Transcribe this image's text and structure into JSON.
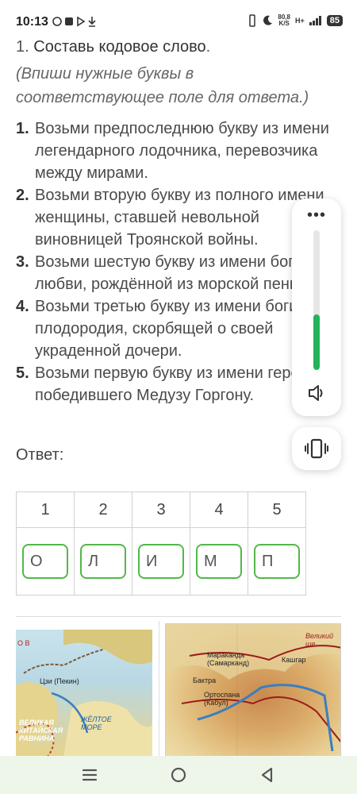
{
  "status_bar": {
    "time": "10:13",
    "speed_value": "80,8",
    "speed_unit": "K/S",
    "network": "H+",
    "battery": "85"
  },
  "task": {
    "number": "1.",
    "title": "Составь кодовое слово",
    "title_dot": ".",
    "subtitle": "(Впиши нужные буквы в соответствующее поле для ответа.)",
    "steps": [
      {
        "num": "1.",
        "text": "Возьми предпоследнюю букву из имени легендарного лодочника, перевозчика между мирами."
      },
      {
        "num": "2.",
        "text": "Возьми вторую букву из полного имени женщины, ставшей невольной виновницей Троянской войны."
      },
      {
        "num": "3.",
        "text": "Возьми шестую букву из имени богини любви, рождённой из морской пены."
      },
      {
        "num": "4.",
        "text": "Возьми третью букву из имени богини плодородия, скорбящей о своей украденной дочери."
      },
      {
        "num": "5.",
        "text": "Возьми первую букву из имени героя, победившего Медузу Горгону."
      }
    ]
  },
  "answer": {
    "label": "Ответ:",
    "headers": [
      "1",
      "2",
      "3",
      "4",
      "5"
    ],
    "values": [
      "О",
      "Л",
      "И",
      "М",
      "П"
    ]
  },
  "maps": {
    "map1_labels": [
      "Цзи (Пекин)",
      "ЖЁЛТОЕ МОРЕ",
      "ВЕЛИКАЯ КИТАЙСКАЯ РАВНИНА",
      "О В"
    ],
    "map2_labels": [
      "Мараканда (Самарканд)",
      "Кашгар",
      "Бактра",
      "Ортоспана (Кабул)",
      "Великий ше"
    ]
  },
  "volume": {
    "level": 0.4
  },
  "colors": {
    "accent_green": "#52b848",
    "volume_green": "#22b35b",
    "navbar_bg": "#eef6e9"
  }
}
